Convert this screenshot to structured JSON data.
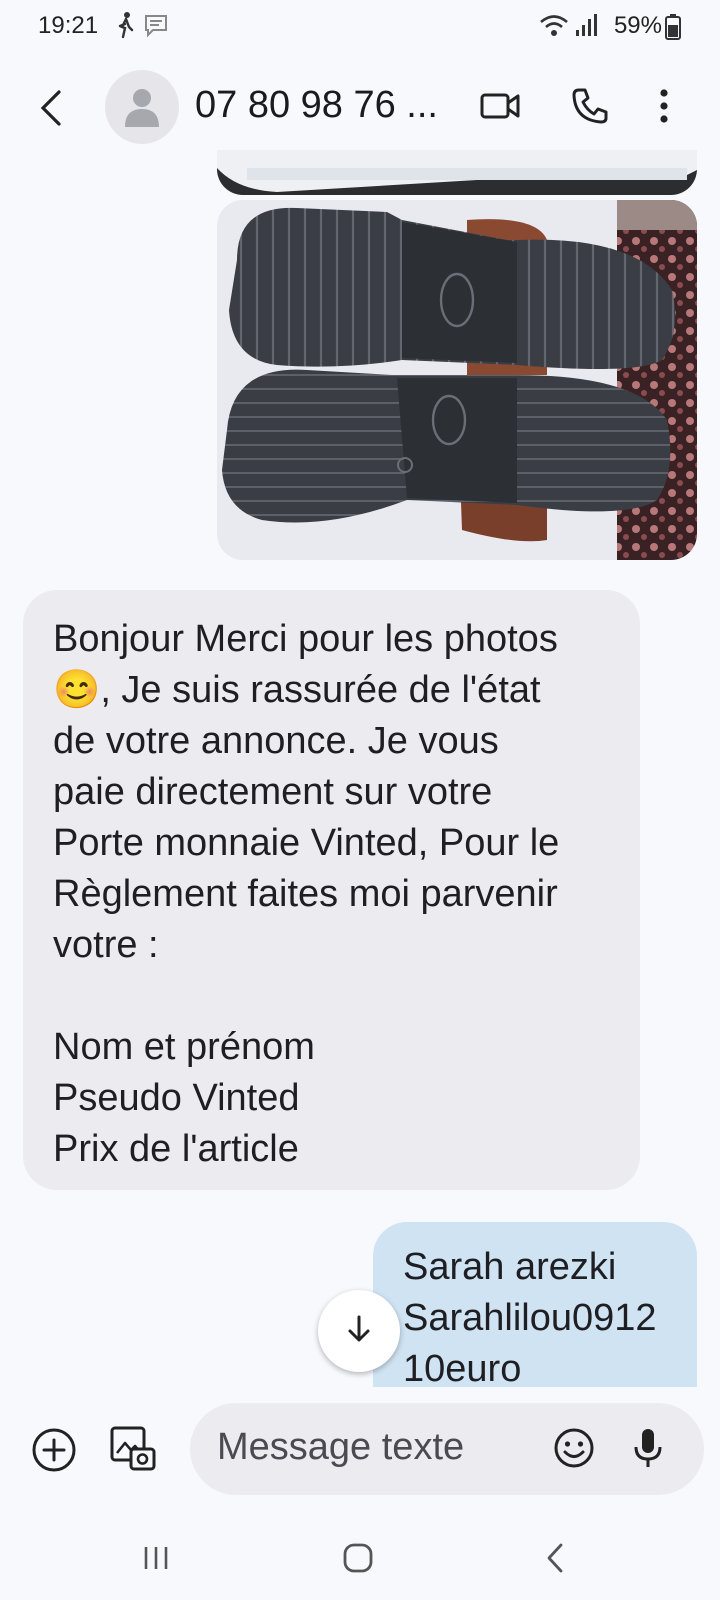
{
  "status_bar": {
    "time": "19:21",
    "battery": "59%",
    "icons": [
      "walking-icon",
      "message-notification-icon",
      "wifi-icon",
      "signal-icon",
      "battery-icon"
    ]
  },
  "app_bar": {
    "contact": "07 80 98 76 ...",
    "icons": [
      "back-arrow-icon",
      "contact-avatar-icon",
      "video-call-icon",
      "phone-call-icon",
      "more-options-icon"
    ]
  },
  "conversation": {
    "photo_messages": [
      "previous-shoe-photo",
      "shoe-soles-photo"
    ],
    "incoming_message": "Bonjour Merci pour les photos\n😊, Je suis rassurée de l'état\nde votre annonce. Je vous\npaie directement sur votre\nPorte monnaie Vinted, Pour le\nRèglement faites moi parvenir\nvotre :\n\nNom et prénom\nPseudo Vinted\nPrix de l'article",
    "outgoing_message": "Sarah arezki\nSarahlilou0912\n10euro"
  },
  "composer": {
    "placeholder": "Message texte",
    "icons": [
      "add-attachment-icon",
      "gallery-camera-icon",
      "emoji-icon",
      "microphone-icon"
    ]
  },
  "scroll_button": {
    "icon": "arrow-down-icon"
  },
  "nav_bar": {
    "icons": [
      "recent-apps-icon",
      "home-icon",
      "back-icon"
    ]
  },
  "colors": {
    "background": "#f8f9fc",
    "incoming_bubble": "#ececf0",
    "outgoing_bubble": "#cfe3f3",
    "text": "#1f1f23"
  }
}
